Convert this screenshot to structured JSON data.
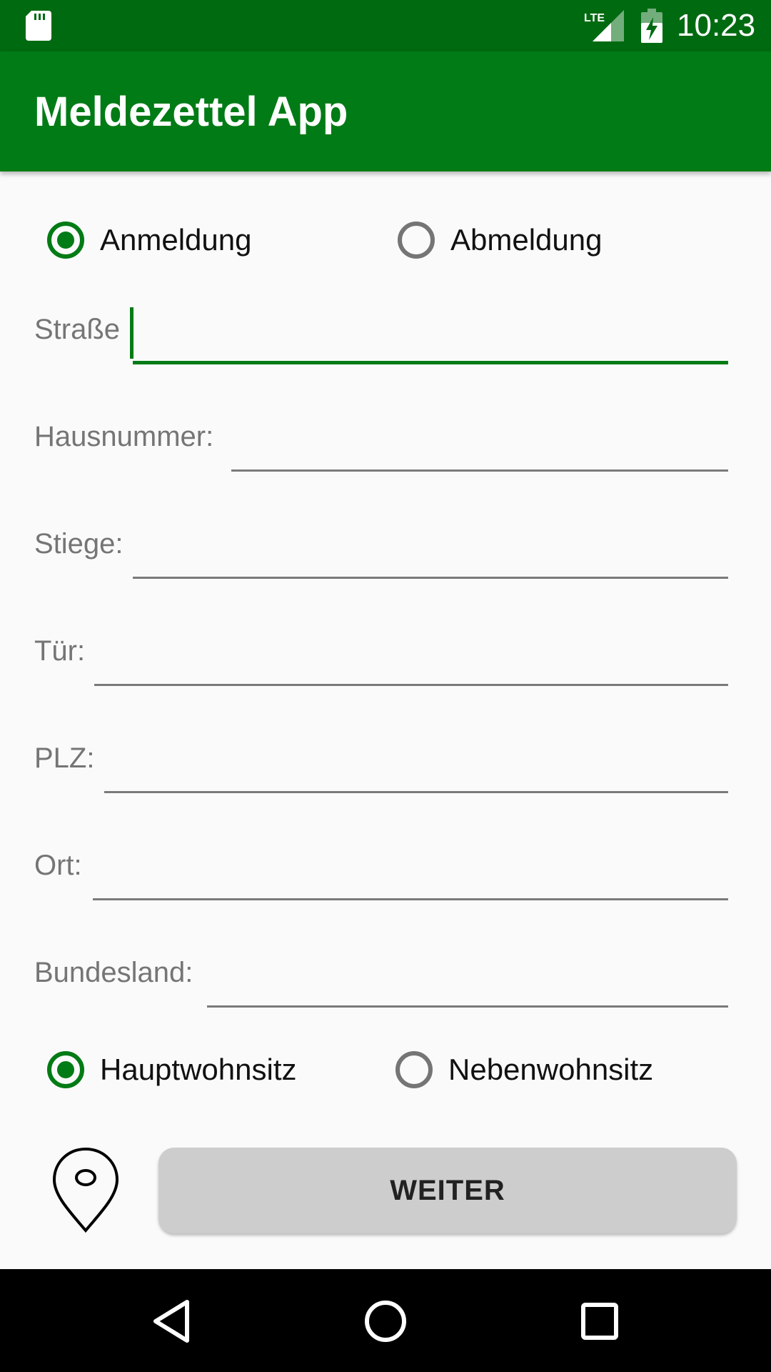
{
  "status_bar": {
    "time": "10:23",
    "network": "LTE",
    "icons": [
      "sd-card-icon",
      "lte-signal-icon",
      "battery-charging-icon"
    ]
  },
  "app_bar": {
    "title": "Meldezettel App"
  },
  "registration_type": {
    "options": [
      {
        "label": "Anmeldung",
        "checked": true
      },
      {
        "label": "Abmeldung",
        "checked": false
      }
    ]
  },
  "form": {
    "fields": [
      {
        "label": "Straße",
        "value": "",
        "focused": true
      },
      {
        "label": "Hausnummer:",
        "value": ""
      },
      {
        "label": "Stiege:",
        "value": ""
      },
      {
        "label": "Tür:",
        "value": ""
      },
      {
        "label": "PLZ:",
        "value": ""
      },
      {
        "label": "Ort:",
        "value": ""
      },
      {
        "label": "Bundesland:",
        "value": ""
      }
    ]
  },
  "residence_type": {
    "options": [
      {
        "label": "Hauptwohnsitz",
        "checked": true
      },
      {
        "label": "Nebenwohnsitz",
        "checked": false
      }
    ]
  },
  "actions": {
    "location_icon": "map-pin-icon",
    "next_label": "WEITER"
  },
  "nav_bar": {
    "icons": [
      "back-icon",
      "home-icon",
      "recents-icon"
    ]
  },
  "colors": {
    "status_bar": "#006a11",
    "app_bar": "#007b15",
    "accent": "#007b15",
    "button": "#cdcdcd"
  }
}
